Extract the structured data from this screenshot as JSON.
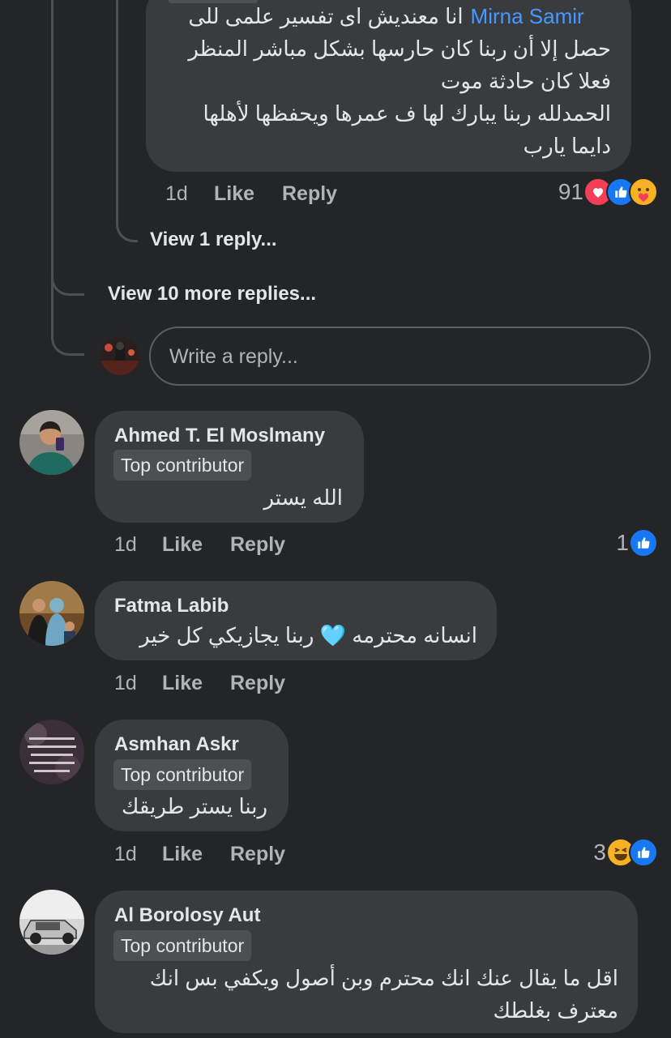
{
  "thread_reply": {
    "author": "Mirna Samir",
    "lines": [
      "انا معنديش اى تفسير علمى للى",
      "حصل إلا أن ربنا كان حارسها بشكل مباشر المنظر",
      "فعلا كان حادثة موت",
      "الحمدلله ربنا يبارك لها ف عمرها ويحفظها لأهلها",
      "دايما يارب"
    ],
    "time": "1d",
    "like": "Like",
    "reply": "Reply",
    "reaction_count": "91",
    "reactions": [
      "heart-icon",
      "like-icon",
      "care-icon"
    ]
  },
  "view_1_reply": "View 1 reply...",
  "view_more_replies": "View 10 more replies...",
  "reply_input": {
    "placeholder": "Write a reply..."
  },
  "comments": [
    {
      "name": "Ahmed T. El Moslmany",
      "badge": "Top contributor",
      "text": [
        "الله يستر"
      ],
      "time": "1d",
      "like": "Like",
      "reply": "Reply",
      "reaction_count": "1",
      "reactions": [
        "like-icon"
      ]
    },
    {
      "name": "Fatma Labib",
      "badge": "",
      "text": [
        "انسانه محترمه 🩵 ربنا يجازيكي كل خير"
      ],
      "time": "1d",
      "like": "Like",
      "reply": "Reply",
      "reaction_count": "",
      "reactions": []
    },
    {
      "name": "Asmhan Askr",
      "badge": "Top contributor",
      "text": [
        "ربنا يستر طريقك"
      ],
      "time": "1d",
      "like": "Like",
      "reply": "Reply",
      "reaction_count": "3",
      "reactions": [
        "haha-icon",
        "like-icon"
      ]
    },
    {
      "name": "Al Borolosy Aut",
      "badge": "Top contributor",
      "text": [
        "اقل ما يقال عنك انك محترم وبن أصول ويكفي بس انك",
        "معترف بغلطك"
      ]
    }
  ],
  "colors": {
    "background": "#242526",
    "bubble": "#3a3b3c",
    "badge": "#4e4f50",
    "mention": "#4599ff",
    "secondary_text": "#b0b3b8",
    "like_blue": "#1877f2",
    "love_red": "#f33e58",
    "emoji_yellow": "#f7b125"
  }
}
